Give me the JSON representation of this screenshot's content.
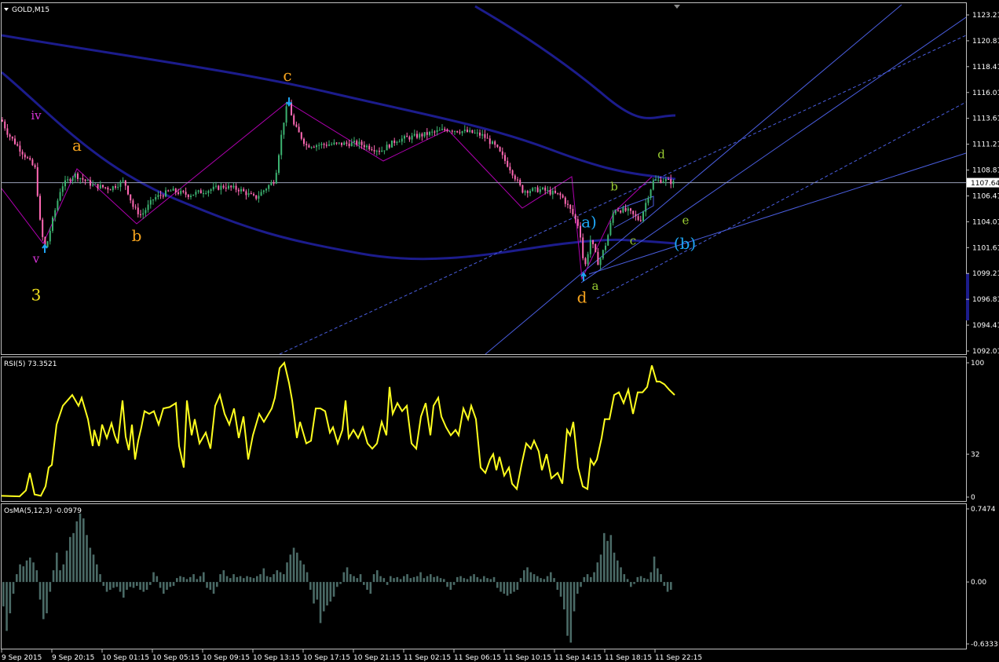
{
  "colors": {
    "background": "#000000",
    "frame": "#c0c0c0",
    "axis_text": "#ffffff",
    "candle_up": "#3cb371",
    "candle_down": "#ff69b4",
    "ma": "#1c1c8c",
    "channel": "#4a5ee0",
    "zigzag": "#b000b0",
    "rsi_line": "#ffff1e",
    "osma_bar": "#4a6a66",
    "wave_orange": "#f5a31e",
    "wave_green": "#9acd32",
    "wave_magenta": "#d633d6",
    "wave_cyan": "#1ea5f5",
    "wave_yellow": "#f2e21e"
  },
  "chart_data": [
    {
      "type": "candlestick",
      "title": "GOLD,M15",
      "symbol": "GOLD",
      "timeframe": "M15",
      "ylim": [
        1092.01,
        1123.21
      ],
      "y_ticks": [
        "1123.21",
        "1120.81",
        "1118.41",
        "1116.01",
        "1113.61",
        "1111.21",
        "1108.81",
        "1106.41",
        "1104.01",
        "1101.61",
        "1099.21",
        "1096.81",
        "1094.41",
        "1092.01"
      ],
      "current_price": "1107.64",
      "x_labels": [
        "9 Sep 2015",
        "9 Sep 20:15",
        "10 Sep 01:15",
        "10 Sep 05:15",
        "10 Sep 09:15",
        "10 Sep 13:15",
        "10 Sep 17:15",
        "10 Sep 21:15",
        "11 Sep 02:15",
        "11 Sep 06:15",
        "11 Sep 10:15",
        "11 Sep 14:15",
        "11 Sep 18:15",
        "11 Sep 22:15"
      ],
      "price_path": [
        [
          0,
          1113.8
        ],
        [
          10,
          1112.2
        ],
        [
          28,
          1110.5
        ],
        [
          45,
          1108.9
        ],
        [
          52,
          1103.2
        ],
        [
          58,
          1101.4
        ],
        [
          66,
          1103.9
        ],
        [
          78,
          1107.3
        ],
        [
          95,
          1108.4
        ],
        [
          118,
          1107.4
        ],
        [
          140,
          1107.1
        ],
        [
          158,
          1107.8
        ],
        [
          170,
          1105.3
        ],
        [
          180,
          1104.6
        ],
        [
          196,
          1106.2
        ],
        [
          218,
          1106.9
        ],
        [
          240,
          1106.5
        ],
        [
          262,
          1106.9
        ],
        [
          285,
          1107.3
        ],
        [
          305,
          1107.0
        ],
        [
          325,
          1106.2
        ],
        [
          350,
          1107.9
        ],
        [
          360,
          1112.9
        ],
        [
          367,
          1115.3
        ],
        [
          374,
          1113.0
        ],
        [
          390,
          1111.1
        ],
        [
          420,
          1111.2
        ],
        [
          455,
          1111.3
        ],
        [
          485,
          1110.6
        ],
        [
          505,
          1111.6
        ],
        [
          540,
          1112.1
        ],
        [
          570,
          1112.6
        ],
        [
          600,
          1112.3
        ],
        [
          615,
          1112.0
        ],
        [
          632,
          1110.9
        ],
        [
          650,
          1108.9
        ],
        [
          665,
          1106.9
        ],
        [
          690,
          1107.0
        ],
        [
          715,
          1106.4
        ],
        [
          728,
          1104.9
        ],
        [
          738,
          1103.4
        ],
        [
          744,
          1099.5
        ],
        [
          752,
          1102.4
        ],
        [
          762,
          1100.1
        ],
        [
          772,
          1102.1
        ],
        [
          782,
          1105.2
        ],
        [
          800,
          1105.0
        ],
        [
          815,
          1104.1
        ],
        [
          825,
          1106.4
        ],
        [
          832,
          1107.8
        ],
        [
          846,
          1107.9
        ],
        [
          859,
          1107.6
        ]
      ],
      "wave_labels": [
        {
          "text": "iv",
          "color": "wave_magenta",
          "price": 1113.5,
          "x": 46
        },
        {
          "text": "v",
          "color": "wave_magenta",
          "price": 1100.2,
          "x": 46
        },
        {
          "text": "3",
          "color": "wave_yellow",
          "price": 1096.7,
          "x": 46
        },
        {
          "text": "a",
          "color": "wave_orange",
          "price": 1110.6,
          "x": 98
        },
        {
          "text": "b",
          "color": "wave_orange",
          "price": 1102.2,
          "x": 174
        },
        {
          "text": "c",
          "color": "wave_orange",
          "price": 1117.1,
          "x": 366
        },
        {
          "text": "d",
          "color": "wave_orange",
          "price": 1096.5,
          "x": 741
        },
        {
          "text": "a)",
          "color": "wave_cyan",
          "price": 1103.5,
          "x": 750
        },
        {
          "text": "(b)",
          "color": "wave_cyan",
          "price": 1101.5,
          "x": 872
        },
        {
          "text": "a",
          "color": "wave_green",
          "price": 1097.7,
          "x": 758
        },
        {
          "text": "b",
          "color": "wave_green",
          "price": 1106.9,
          "x": 782
        },
        {
          "text": "c",
          "color": "wave_green",
          "price": 1101.9,
          "x": 806
        },
        {
          "text": "d",
          "color": "wave_green",
          "price": 1109.9,
          "x": 842
        },
        {
          "text": "e",
          "color": "wave_green",
          "price": 1103.8,
          "x": 873
        }
      ]
    },
    {
      "type": "line",
      "title": "RSI(5) 73.3521",
      "ylim": [
        0,
        100
      ],
      "y_ticks": [
        "100",
        "32",
        "0"
      ],
      "current": 73.3521,
      "series": [
        {
          "values": [
            [
              0,
              1
            ],
            [
              25,
              0.5
            ],
            [
              33,
              5
            ],
            [
              38,
              18
            ],
            [
              44,
              2
            ],
            [
              52,
              1
            ],
            [
              58,
              8
            ],
            [
              62,
              22
            ],
            [
              66,
              24
            ],
            [
              72,
              54
            ],
            [
              80,
              68
            ],
            [
              92,
              76
            ],
            [
              100,
              68
            ],
            [
              104,
              74
            ],
            [
              112,
              58
            ],
            [
              118,
              38
            ],
            [
              120,
              50
            ],
            [
              126,
              38
            ],
            [
              130,
              54
            ],
            [
              136,
              44
            ],
            [
              142,
              55
            ],
            [
              146,
              46
            ],
            [
              150,
              40
            ],
            [
              156,
              72
            ],
            [
              160,
              45
            ],
            [
              164,
              35
            ],
            [
              168,
              54
            ],
            [
              172,
              28
            ],
            [
              176,
              42
            ],
            [
              180,
              52
            ],
            [
              184,
              64
            ],
            [
              190,
              62
            ],
            [
              196,
              64
            ],
            [
              202,
              54
            ],
            [
              208,
              66
            ],
            [
              216,
              67
            ],
            [
              224,
              70
            ],
            [
              228,
              38
            ],
            [
              234,
              22
            ],
            [
              238,
              72
            ],
            [
              244,
              46
            ],
            [
              248,
              58
            ],
            [
              254,
              40
            ],
            [
              262,
              48
            ],
            [
              268,
              36
            ],
            [
              274,
              68
            ],
            [
              280,
              76
            ],
            [
              286,
              62
            ],
            [
              292,
              54
            ],
            [
              298,
              66
            ],
            [
              304,
              44
            ],
            [
              310,
              60
            ],
            [
              316,
              28
            ],
            [
              322,
              46
            ],
            [
              330,
              62
            ],
            [
              336,
              56
            ],
            [
              342,
              62
            ],
            [
              346,
              66
            ],
            [
              350,
              74
            ],
            [
              356,
              96
            ],
            [
              362,
              100
            ],
            [
              368,
              85
            ],
            [
              372,
              72
            ],
            [
              378,
              44
            ],
            [
              382,
              56
            ],
            [
              386,
              48
            ],
            [
              390,
              40
            ],
            [
              396,
              42
            ],
            [
              402,
              66
            ],
            [
              408,
              66
            ],
            [
              414,
              64
            ],
            [
              420,
              48
            ],
            [
              424,
              52
            ],
            [
              430,
              40
            ],
            [
              436,
              50
            ],
            [
              440,
              72
            ],
            [
              444,
              44
            ],
            [
              450,
              50
            ],
            [
              456,
              44
            ],
            [
              462,
              52
            ],
            [
              468,
              40
            ],
            [
              474,
              36
            ],
            [
              480,
              40
            ],
            [
              486,
              56
            ],
            [
              492,
              46
            ],
            [
              496,
              82
            ],
            [
              500,
              62
            ],
            [
              506,
              70
            ],
            [
              512,
              64
            ],
            [
              518,
              68
            ],
            [
              524,
              40
            ],
            [
              530,
              36
            ],
            [
              536,
              60
            ],
            [
              542,
              70
            ],
            [
              548,
              46
            ],
            [
              552,
              68
            ],
            [
              558,
              74
            ],
            [
              562,
              60
            ],
            [
              568,
              52
            ],
            [
              574,
              46
            ],
            [
              580,
              50
            ],
            [
              584,
              46
            ],
            [
              590,
              66
            ],
            [
              596,
              58
            ],
            [
              600,
              68
            ],
            [
              606,
              58
            ],
            [
              612,
              22
            ],
            [
              618,
              18
            ],
            [
              624,
              28
            ],
            [
              628,
              32
            ],
            [
              632,
              20
            ],
            [
              636,
              30
            ],
            [
              642,
              16
            ],
            [
              648,
              22
            ],
            [
              652,
              10
            ],
            [
              658,
              6
            ],
            [
              664,
              24
            ],
            [
              670,
              40
            ],
            [
              676,
              36
            ],
            [
              680,
              42
            ],
            [
              686,
              34
            ],
            [
              690,
              20
            ],
            [
              696,
              32
            ],
            [
              702,
              14
            ],
            [
              710,
              18
            ],
            [
              716,
              10
            ],
            [
              722,
              50
            ],
            [
              726,
              46
            ],
            [
              730,
              56
            ],
            [
              736,
              22
            ],
            [
              742,
              8
            ],
            [
              748,
              6
            ],
            [
              752,
              28
            ],
            [
              756,
              24
            ],
            [
              760,
              28
            ],
            [
              766,
              44
            ],
            [
              770,
              58
            ],
            [
              776,
              58
            ],
            [
              782,
              76
            ],
            [
              788,
              78
            ],
            [
              794,
              70
            ],
            [
              800,
              80
            ],
            [
              806,
              62
            ],
            [
              812,
              78
            ],
            [
              818,
              78
            ],
            [
              824,
              82
            ],
            [
              830,
              98
            ],
            [
              836,
              86
            ],
            [
              840,
              86
            ],
            [
              846,
              84
            ],
            [
              852,
              80
            ],
            [
              859,
              76
            ]
          ]
        }
      ]
    },
    {
      "type": "bar",
      "title": "OsMA(5,12,3) -0.0979",
      "ylim": [
        -0.6333,
        0.7474
      ],
      "y_ticks": [
        "0.7474",
        "0.00",
        "-0.6333"
      ],
      "current": -0.0979,
      "values": [
        -0.25,
        -0.5,
        -0.32,
        -0.12,
        0.08,
        0.18,
        0.16,
        0.22,
        0.25,
        0.2,
        0.12,
        -0.18,
        -0.38,
        -0.32,
        -0.1,
        0.12,
        0.3,
        0.12,
        0.18,
        0.32,
        0.46,
        0.5,
        0.62,
        0.7,
        0.65,
        0.48,
        0.35,
        0.28,
        0.18,
        0.08,
        -0.04,
        -0.1,
        -0.08,
        -0.06,
        -0.05,
        -0.1,
        -0.16,
        -0.08,
        -0.05,
        -0.06,
        -0.04,
        -0.08,
        -0.1,
        -0.08,
        -0.03,
        0.1,
        0.06,
        -0.06,
        -0.12,
        -0.08,
        -0.05,
        -0.04,
        0.04,
        0.06,
        0.05,
        0.03,
        0.05,
        0.08,
        0.03,
        0.06,
        0.1,
        -0.06,
        -0.08,
        -0.12,
        -0.05,
        0.08,
        0.12,
        0.06,
        0.04,
        0.08,
        0.05,
        0.06,
        0.04,
        0.06,
        0.05,
        0.04,
        0.06,
        0.08,
        0.14,
        0.06,
        0.05,
        0.08,
        0.12,
        0.1,
        0.08,
        0.2,
        0.28,
        0.35,
        0.3,
        0.22,
        0.18,
        0.1,
        -0.08,
        -0.22,
        -0.18,
        -0.42,
        -0.3,
        -0.24,
        -0.2,
        -0.15,
        -0.05,
        -0.02,
        0.1,
        0.15,
        0.08,
        0.06,
        0.04,
        0.08,
        -0.03,
        -0.08,
        -0.12,
        0.08,
        0.12,
        0.06,
        0.04,
        -0.03,
        0.06,
        0.04,
        0.05,
        0.03,
        0.06,
        0.08,
        0.04,
        0.05,
        0.06,
        0.1,
        0.04,
        0.06,
        0.08,
        0.05,
        0.06,
        0.04,
        0.03,
        -0.05,
        -0.08,
        -0.03,
        0.05,
        0.06,
        0.04,
        0.03,
        0.06,
        0.08,
        0.05,
        0.03,
        0.06,
        0.04,
        0.03,
        0.05,
        -0.06,
        -0.1,
        -0.12,
        -0.14,
        -0.12,
        -0.1,
        -0.08,
        0.04,
        0.12,
        0.15,
        0.1,
        0.08,
        0.06,
        0.04,
        0.03,
        0.06,
        0.1,
        0.04,
        -0.08,
        -0.15,
        -0.28,
        -0.55,
        -0.62,
        -0.3,
        -0.12,
        -0.05,
        0.05,
        0.08,
        0.05,
        0.1,
        0.2,
        0.28,
        0.5,
        0.42,
        0.48,
        0.3,
        0.22,
        0.15,
        0.08,
        0.03,
        -0.05,
        -0.02,
        0.05,
        0.06,
        0.04,
        0.03,
        0.1,
        0.26,
        0.14,
        0.08,
        -0.04,
        -0.1,
        -0.08
      ]
    }
  ]
}
